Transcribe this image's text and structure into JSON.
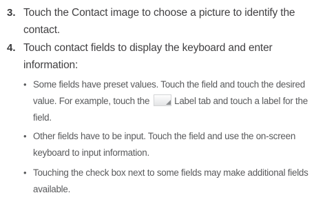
{
  "steps": [
    {
      "number": "3.",
      "text": "Touch the Contact image to choose a picture to identify the contact."
    },
    {
      "number": "4.",
      "text": "Touch contact fields to display the keyboard and enter information:"
    }
  ],
  "bullets": [
    {
      "marker": "•",
      "text_before": "Some fields have preset values. Touch the field and touch the desired value. For example, touch the",
      "icon": "label-tab-icon",
      "text_after": "Label tab and touch a label for the field."
    },
    {
      "marker": "•",
      "text": "Other fields have to be input. Touch the field and use the on-screen keyboard to input information."
    },
    {
      "marker": "•",
      "text": "Touching the check box next to some fields may make additional fields available."
    }
  ]
}
